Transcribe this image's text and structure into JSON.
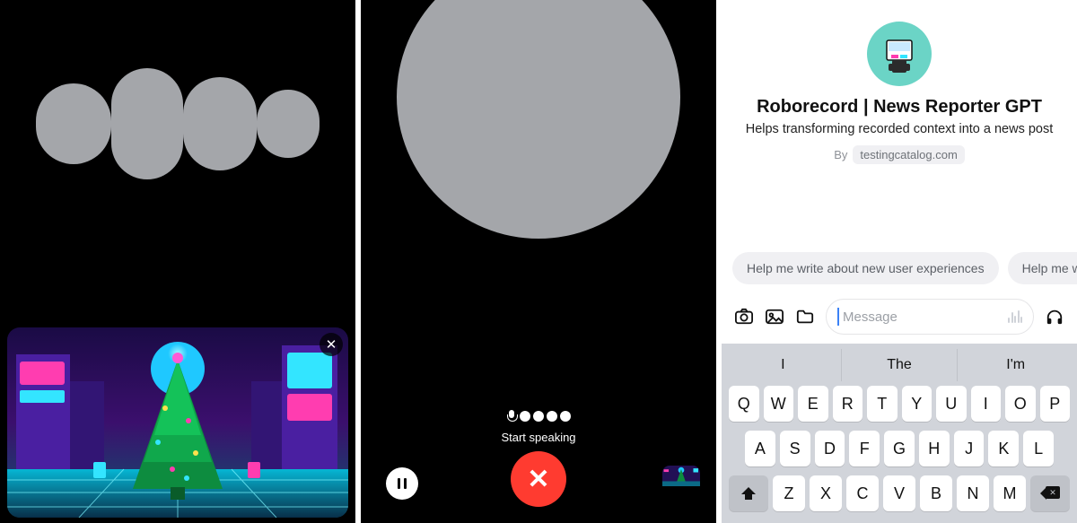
{
  "panel1": {
    "image_close_label": "✕"
  },
  "panel2": {
    "start_speaking": "Start speaking",
    "end_label": "✕"
  },
  "panel3": {
    "gpt_name": "Roborecord | News Reporter GPT",
    "gpt_description": "Helps transforming recorded context into a news post",
    "by_prefix": "By",
    "by_author": "testingcatalog.com",
    "prompts": [
      "Help me write about new user experiences",
      "Help me w"
    ],
    "input_placeholder": "Message",
    "keyboard": {
      "suggestions": [
        "I",
        "The",
        "I'm"
      ],
      "row1": [
        "Q",
        "W",
        "E",
        "R",
        "T",
        "Y",
        "U",
        "I",
        "O",
        "P"
      ],
      "row2": [
        "A",
        "S",
        "D",
        "F",
        "G",
        "H",
        "J",
        "K",
        "L"
      ],
      "row3": [
        "Z",
        "X",
        "C",
        "V",
        "B",
        "N",
        "M"
      ]
    }
  }
}
